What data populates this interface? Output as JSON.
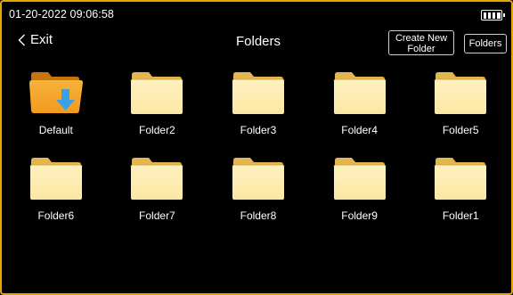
{
  "status": {
    "datetime": "01-20-2022 09:06:58",
    "battery_icon": "battery-full-icon"
  },
  "header": {
    "back_label": "Exit",
    "title": "Folders",
    "create_line1": "Create New",
    "create_line2": "Folder",
    "folders_button": "Folders"
  },
  "folders": [
    {
      "name": "Default",
      "icon": "folder-download-icon"
    },
    {
      "name": "Folder2",
      "icon": "folder-icon"
    },
    {
      "name": "Folder3",
      "icon": "folder-icon"
    },
    {
      "name": "Folder4",
      "icon": "folder-icon"
    },
    {
      "name": "Folder5",
      "icon": "folder-icon"
    },
    {
      "name": "Folder6",
      "icon": "folder-icon"
    },
    {
      "name": "Folder7",
      "icon": "folder-icon"
    },
    {
      "name": "Folder8",
      "icon": "folder-icon"
    },
    {
      "name": "Folder9",
      "icon": "folder-icon"
    },
    {
      "name": "Folder1",
      "icon": "folder-icon"
    }
  ],
  "colors": {
    "frame_border": "#e8a400",
    "folder_light": "#fbe7a4",
    "folder_dark": "#e3b64f",
    "default_folder": "#f29a1e",
    "download_arrow": "#3aa0e8"
  }
}
